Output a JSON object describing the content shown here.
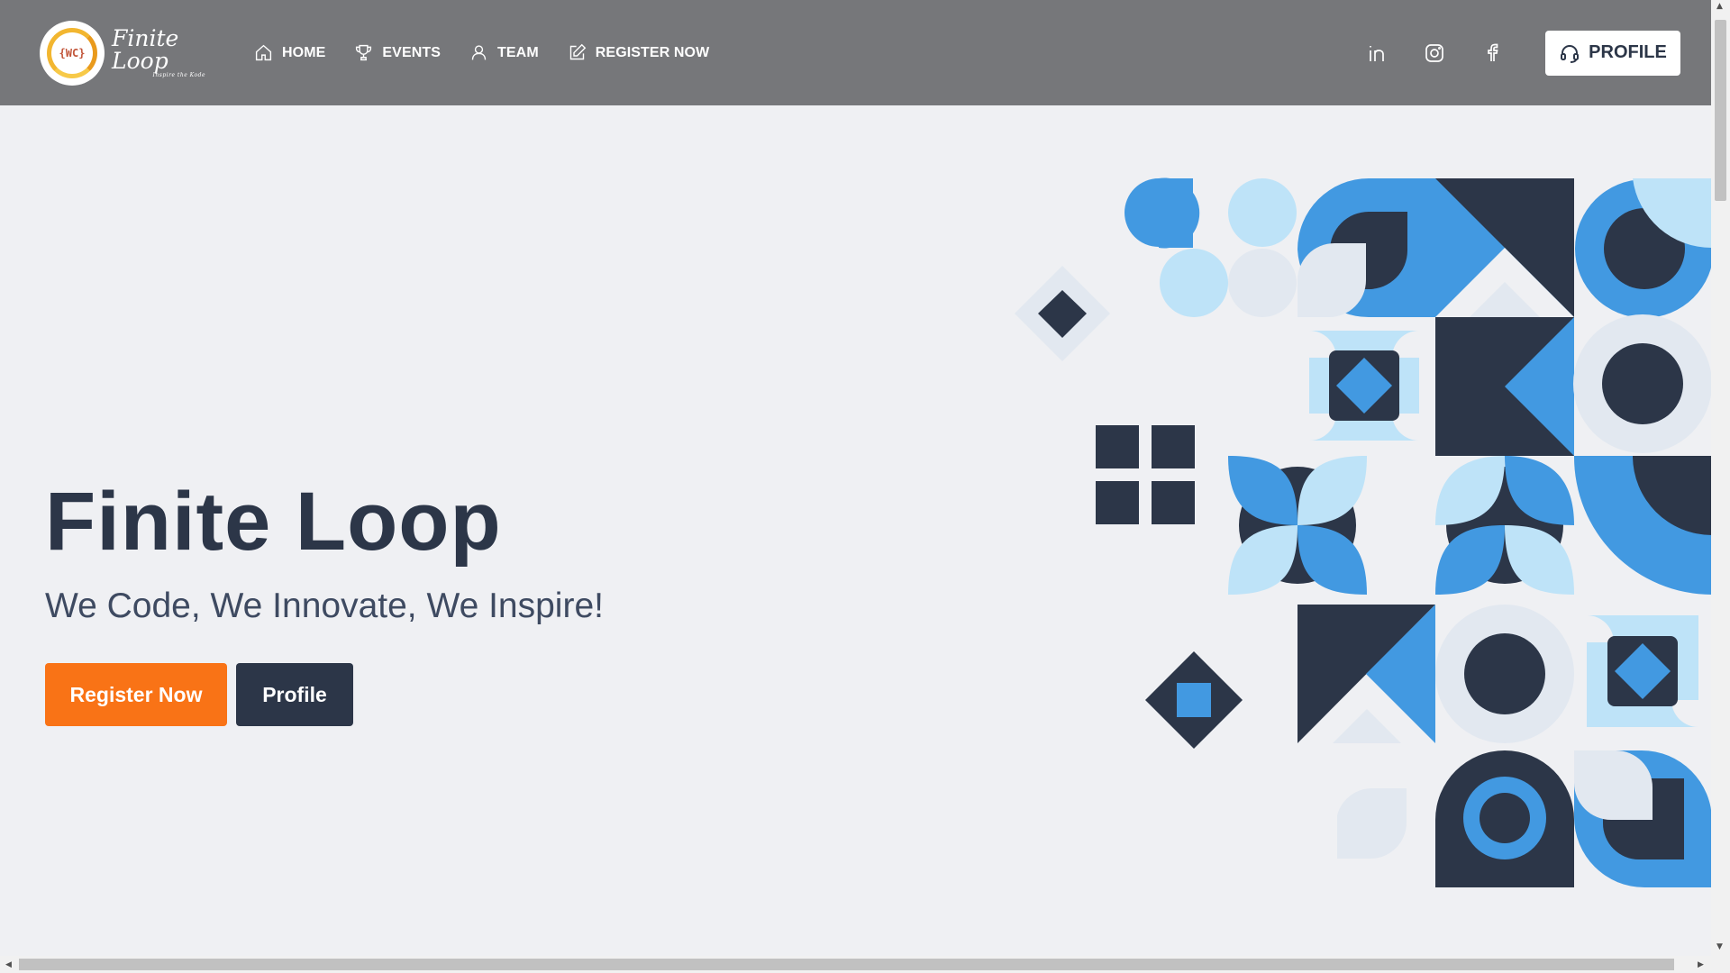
{
  "brand": {
    "logo_text": "Finite Loop",
    "logo_tagline": "Inspire the Kode",
    "logo_badge": "{WC}"
  },
  "nav": {
    "items": [
      {
        "label": "HOME",
        "icon": "home-icon"
      },
      {
        "label": "EVENTS",
        "icon": "trophy-icon"
      },
      {
        "label": "TEAM",
        "icon": "user-icon"
      },
      {
        "label": "REGISTER NOW",
        "icon": "edit-icon"
      }
    ],
    "social": [
      "linkedin-icon",
      "instagram-icon",
      "facebook-icon"
    ],
    "profile_label": "PROFILE",
    "profile_icon": "headset-icon"
  },
  "hero": {
    "title": "Finite Loop",
    "subtitle": "We Code, We Innovate, We Inspire!",
    "primary_button": "Register Now",
    "secondary_button": "Profile"
  },
  "colors": {
    "navbar": "#76777a",
    "background": "#eff0f3",
    "dark_navy": "#2c3648",
    "accent_orange": "#f97316",
    "blue": "#4299e1",
    "light_blue": "#bee3f8",
    "pale": "#e2e8f0"
  }
}
